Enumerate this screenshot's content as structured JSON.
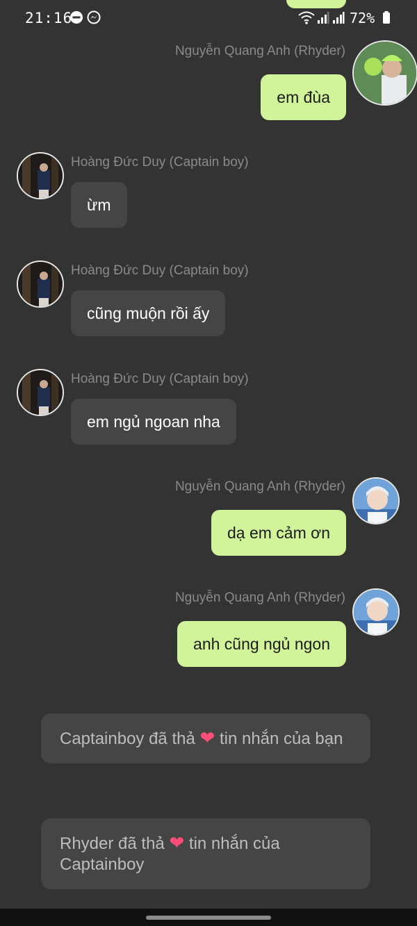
{
  "status_bar": {
    "time": "21:16",
    "battery": "72%",
    "icons": [
      "do-not-disturb-icon",
      "messenger-icon",
      "wifi-icon",
      "signal-icon",
      "signal-icon",
      "battery-icon"
    ]
  },
  "colors": {
    "background": "#333333",
    "outgoing_bubble": "#d1f39a",
    "incoming_bubble": "#454545",
    "name_text": "#8a8a8a",
    "heart": "#ff4f78"
  },
  "messages": [
    {
      "sender": "Nguyễn Quang Anh (Rhyder)",
      "text": "em đùa",
      "direction": "out"
    },
    {
      "sender": "Hoàng Đức Duy (Captain boy)",
      "text": "ừm",
      "direction": "in"
    },
    {
      "sender": "Hoàng Đức Duy (Captain boy)",
      "text": "cũng muộn rồi ấy",
      "direction": "in"
    },
    {
      "sender": "Hoàng Đức Duy (Captain boy)",
      "text": "em ngủ ngoan nha",
      "direction": "in"
    },
    {
      "sender": "Nguyễn Quang Anh (Rhyder)",
      "text": "dạ em cảm ơn",
      "direction": "out"
    },
    {
      "sender": "Nguyễn Quang Anh (Rhyder)",
      "text": "anh cũng ngủ ngon",
      "direction": "out"
    }
  ],
  "notices": [
    {
      "before": "Captainboy đã thả",
      "emoji": "❤",
      "after": "tin nhắn của bạn"
    },
    {
      "before": "Rhyder đã thả",
      "emoji": "❤",
      "after": "tin nhắn của Captainboy"
    }
  ]
}
